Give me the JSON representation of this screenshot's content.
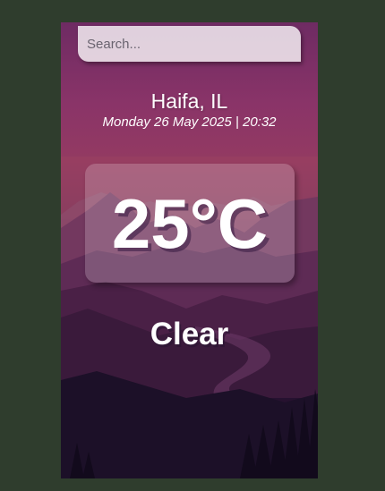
{
  "search": {
    "placeholder": "Search...",
    "value": ""
  },
  "location": {
    "city": "Haifa, IL",
    "datetime": "Monday 26 May 2025 | 20:32"
  },
  "weather": {
    "temperature": "25°C",
    "condition": "Clear"
  },
  "colors": {
    "page_background": "#2f3d2d",
    "sky_top": "#6e2b63",
    "sky_mid": "#933a62",
    "ground_bottom": "#0e0a1e",
    "text": "#ffffff"
  }
}
